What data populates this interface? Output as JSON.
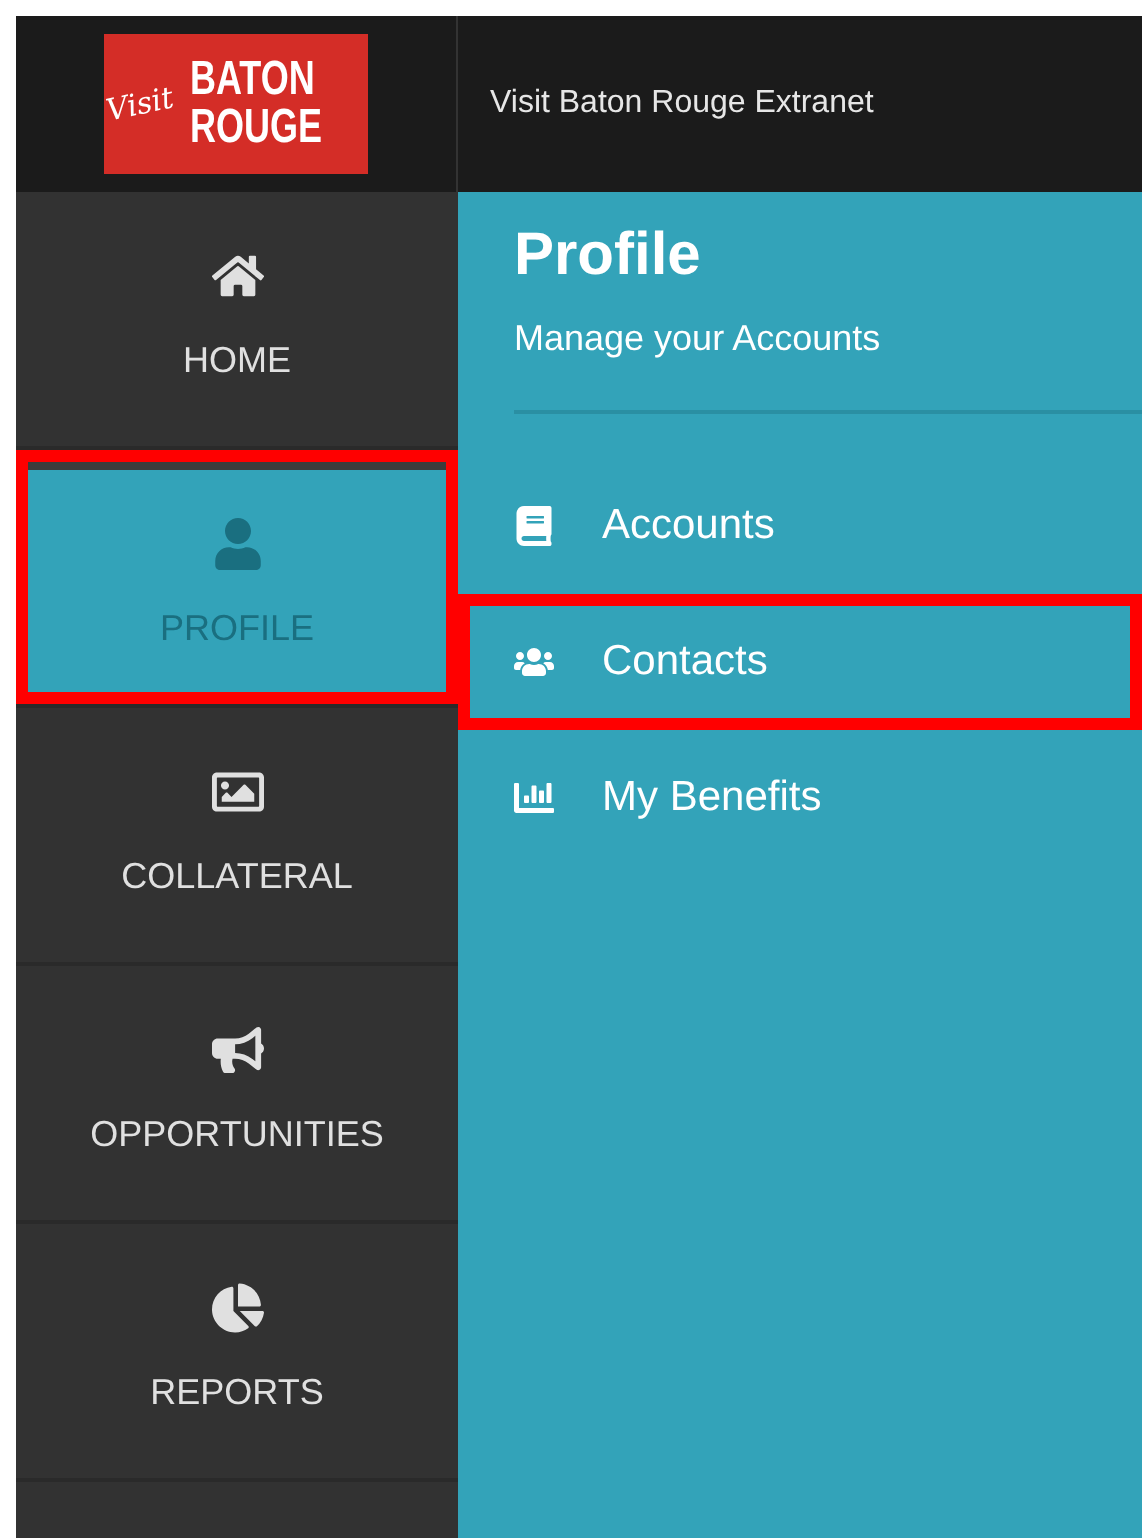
{
  "header": {
    "logo": {
      "script": "Visit",
      "line_1": "BATON",
      "line_2": "ROUGE"
    },
    "title": "Visit Baton Rouge Extranet"
  },
  "sidebar": {
    "items": [
      {
        "label": "HOME",
        "kind": "home",
        "selected": false,
        "highlighted": false
      },
      {
        "label": "PROFILE",
        "kind": "user",
        "selected": true,
        "highlighted": true
      },
      {
        "label": "COLLATERAL",
        "kind": "image",
        "selected": false,
        "highlighted": false
      },
      {
        "label": "OPPORTUNITIES",
        "kind": "megaphone",
        "selected": false,
        "highlighted": false
      },
      {
        "label": "REPORTS",
        "kind": "pie",
        "selected": false,
        "highlighted": false
      }
    ]
  },
  "panel": {
    "title": "Profile",
    "subtitle": "Manage your Accounts",
    "items": [
      {
        "label": "Accounts",
        "kind": "book",
        "highlighted": false
      },
      {
        "label": "Contacts",
        "kind": "users",
        "highlighted": true
      },
      {
        "label": "My Benefits",
        "kind": "chart",
        "highlighted": false
      }
    ]
  }
}
